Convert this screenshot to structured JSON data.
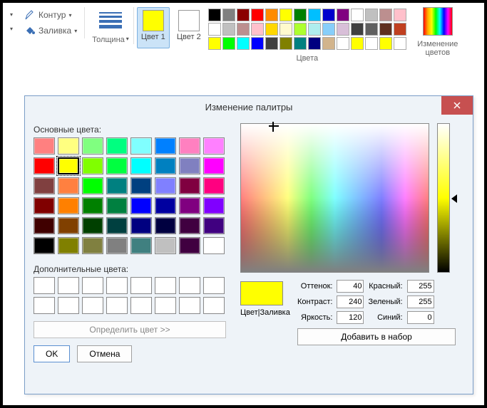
{
  "ribbon": {
    "kontur_label": "Контур",
    "zalivka_label": "Заливка",
    "thickness_label": "Толщина",
    "color1_label": "Цвет 1",
    "color2_label": "Цвет 2",
    "colors_group_label": "Цвета",
    "edit_colors_label": "Изменение цветов",
    "color1_value": "#ffff00",
    "color2_value": "#ffffff",
    "palette_row1": [
      "#000000",
      "#808080",
      "#8b0000",
      "#ff0000",
      "#ff8c00",
      "#ffff00",
      "#008000",
      "#00bfff",
      "#0000cd",
      "#800080",
      "#ffffff",
      "#c0c0c0",
      "#bc8f8f",
      "#ffc0cb"
    ],
    "palette_row2": [
      "#ffffff",
      "#c0c0c0",
      "#bc8f8f",
      "#ffc0cb",
      "#ffd700",
      "#fffacd",
      "#adff2f",
      "#afeeee",
      "#87cefa",
      "#d8bfd8",
      "#404040",
      "#606060",
      "#603020",
      "#c04020"
    ],
    "palette_row3": [
      "#ffff00",
      "#00ff00",
      "#00ffff",
      "#0000ff",
      "#404040",
      "#808000",
      "#008080",
      "#000080",
      "#d2b48c",
      "#ffffff",
      "#ffff00",
      "#ffffff",
      "#ffff00",
      "#ffffff"
    ]
  },
  "dialog": {
    "title": "Изменение палитры",
    "basic_label": "Основные цвета:",
    "custom_label": "Дополнительные цвета:",
    "define_label": "Определить цвет >>",
    "ok_label": "OK",
    "cancel_label": "Отмена",
    "preview_label": "Цвет|Заливка",
    "hue_label": "Оттенок:",
    "sat_label": "Контраст:",
    "lum_label": "Яркость:",
    "red_label": "Красный:",
    "green_label": "Зеленый:",
    "blue_label": "Синий:",
    "add_label": "Добавить в набор",
    "hue": "40",
    "sat": "240",
    "lum": "120",
    "red": "255",
    "green": "255",
    "blue": "0",
    "preview_color": "#ffff00",
    "basic_colors": [
      "#ff8080",
      "#ffff80",
      "#80ff80",
      "#00ff80",
      "#80ffff",
      "#0080ff",
      "#ff80c0",
      "#ff80ff",
      "#ff0000",
      "#ffff00",
      "#80ff00",
      "#00ff40",
      "#00ffff",
      "#0080c0",
      "#8080c0",
      "#ff00ff",
      "#804040",
      "#ff8040",
      "#00ff00",
      "#008080",
      "#004080",
      "#8080ff",
      "#800040",
      "#ff0080",
      "#800000",
      "#ff8000",
      "#008000",
      "#008040",
      "#0000ff",
      "#0000a0",
      "#800080",
      "#8000ff",
      "#400000",
      "#804000",
      "#004000",
      "#004040",
      "#000080",
      "#000040",
      "#400040",
      "#400080",
      "#000000",
      "#808000",
      "#808040",
      "#808080",
      "#408080",
      "#c0c0c0",
      "#400040",
      "#ffffff"
    ],
    "selected_basic_index": 9
  }
}
